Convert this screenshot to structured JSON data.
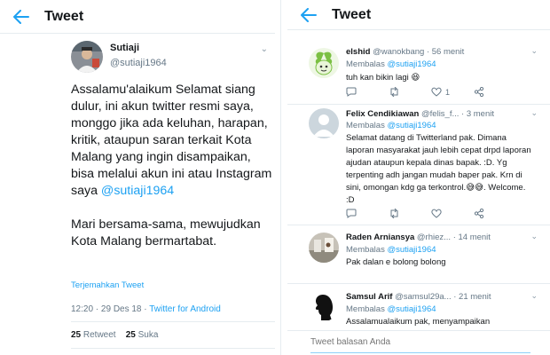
{
  "colors": {
    "accent": "#1da1f2",
    "muted": "#657786",
    "border": "#e6ecf0"
  },
  "left": {
    "title": "Tweet",
    "author": {
      "name": "Sutiaji",
      "handle": "@sutiaji1964"
    },
    "body": {
      "p1": "Assalamu'alaikum Selamat siang dulur, ini akun twitter resmi saya, monggo jika ada keluhan, harapan, kritik, ataupun saran terkait Kota Malang yang ingin disampaikan, bisa melalui akun ini atau Instagram saya ",
      "mention": "@sutiaji1964",
      "p2": "Mari bersama-sama, mewujudkan Kota Malang bermartabat."
    },
    "translate": "Terjemahkan Tweet",
    "meta": {
      "time": "12:20 · 29 Des 18 · ",
      "client": "Twitter for Android"
    },
    "stats": {
      "retweet_count": "25",
      "retweet_label": " Retweet",
      "like_count": "25",
      "like_label": " Suka"
    }
  },
  "right": {
    "title": "Tweet",
    "replies": [
      {
        "name": "elshid",
        "handle": " @wanokbang · 56 menit",
        "replying_prefix": "Membalas ",
        "replying_to": "@sutiaji1964",
        "text": "tuh kan bikin lagi 😆",
        "likes": "1"
      },
      {
        "name": "Felix Cendikiawan",
        "handle": " @felis_f... · 3 menit",
        "replying_prefix": "Membalas ",
        "replying_to": "@sutiaji1964",
        "text": "Selamat datang di Twitterland pak. Dimana laporan masyarakat jauh lebih cepat drpd laporan ajudan ataupun kepala dinas bapak. :D. Yg terpenting adh jangan mudah baper pak. Krn di sini, omongan kdg ga terkontrol.😅😅. Welcome. :D",
        "likes": ""
      },
      {
        "name": "Raden Arniansya",
        "handle": " @rhiez... · 14 menit",
        "replying_prefix": "Membalas ",
        "replying_to": "@sutiaji1964",
        "text": "Pak dalan e bolong bolong",
        "likes": ""
      },
      {
        "name": "Samsul Arif",
        "handle": " @samsul29a... · 21 menit",
        "replying_prefix": "Membalas ",
        "replying_to": "@sutiaji1964",
        "text": "Assalamualaikum pak, menyampaikan",
        "likes": ""
      }
    ],
    "reply_placeholder": "Tweet balasan Anda"
  }
}
